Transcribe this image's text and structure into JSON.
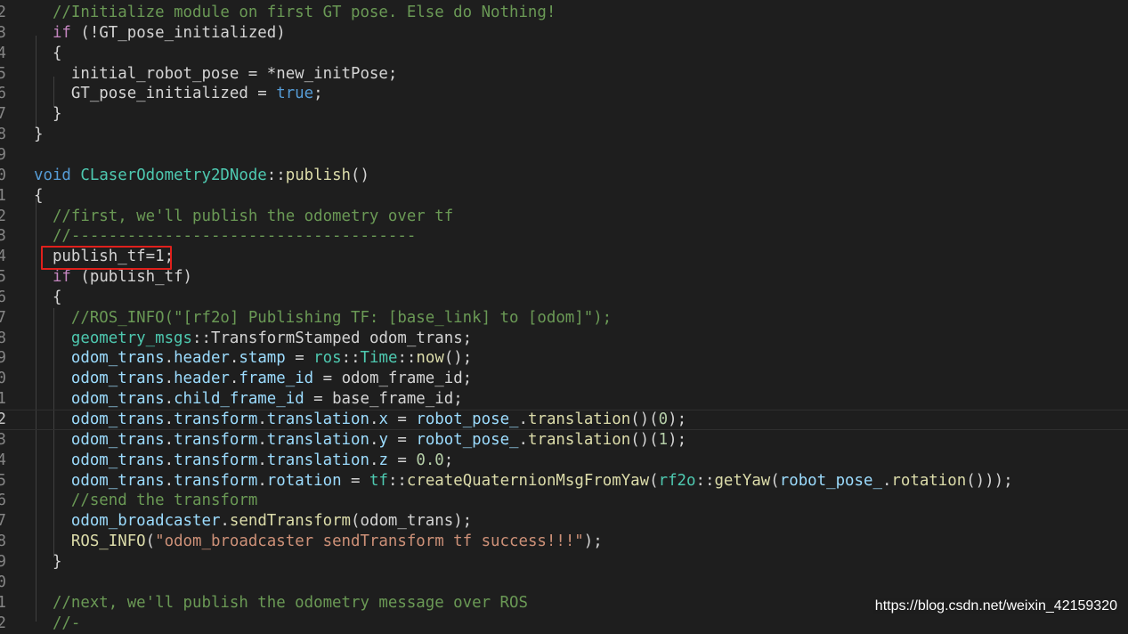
{
  "editor": {
    "lines": [
      {
        "num": "2",
        "tokens": [
          {
            "t": "  ",
            "c": "pl"
          },
          {
            "t": "//Initialize module on first GT pose. Else do Nothing!",
            "c": "cm"
          }
        ]
      },
      {
        "num": "3",
        "tokens": [
          {
            "t": "  ",
            "c": "pl"
          },
          {
            "t": "if",
            "c": "kc"
          },
          {
            "t": " (!GT_pose_initialized)",
            "c": "pl"
          }
        ]
      },
      {
        "num": "4",
        "tokens": [
          {
            "t": "  {",
            "c": "pl"
          }
        ]
      },
      {
        "num": "5",
        "tokens": [
          {
            "t": "    initial_robot_pose = *new_initPose;",
            "c": "pl"
          }
        ]
      },
      {
        "num": "6",
        "tokens": [
          {
            "t": "    GT_pose_initialized = ",
            "c": "pl"
          },
          {
            "t": "true",
            "c": "kw"
          },
          {
            "t": ";",
            "c": "pl"
          }
        ]
      },
      {
        "num": "7",
        "tokens": [
          {
            "t": "  }",
            "c": "pl"
          }
        ]
      },
      {
        "num": "8",
        "tokens": [
          {
            "t": "}",
            "c": "pl"
          }
        ]
      },
      {
        "num": "9",
        "tokens": []
      },
      {
        "num": "0",
        "tokens": [
          {
            "t": "void",
            "c": "kw"
          },
          {
            "t": " ",
            "c": "pl"
          },
          {
            "t": "CLaserOdometry2DNode",
            "c": "ty"
          },
          {
            "t": "::",
            "c": "pl"
          },
          {
            "t": "publish",
            "c": "fn"
          },
          {
            "t": "()",
            "c": "pl"
          }
        ]
      },
      {
        "num": "1",
        "tokens": [
          {
            "t": "{",
            "c": "pl"
          }
        ]
      },
      {
        "num": "2",
        "tokens": [
          {
            "t": "  ",
            "c": "pl"
          },
          {
            "t": "//first, we'll publish the odometry over tf",
            "c": "cm"
          }
        ]
      },
      {
        "num": "3",
        "tokens": [
          {
            "t": "  ",
            "c": "pl"
          },
          {
            "t": "//-------------------------------------",
            "c": "cm"
          }
        ]
      },
      {
        "num": "4",
        "tokens": [
          {
            "t": "  publish_tf=1;",
            "c": "pl"
          }
        ]
      },
      {
        "num": "5",
        "tokens": [
          {
            "t": "  ",
            "c": "pl"
          },
          {
            "t": "if",
            "c": "kc"
          },
          {
            "t": " (publish_tf)",
            "c": "pl"
          }
        ]
      },
      {
        "num": "6",
        "tokens": [
          {
            "t": "  {",
            "c": "pl"
          }
        ]
      },
      {
        "num": "7",
        "tokens": [
          {
            "t": "    ",
            "c": "pl"
          },
          {
            "t": "//ROS_INFO(\"[rf2o] Publishing TF: [base_link] to [odom]\");",
            "c": "cm"
          }
        ]
      },
      {
        "num": "8",
        "tokens": [
          {
            "t": "    ",
            "c": "pl"
          },
          {
            "t": "geometry_msgs",
            "c": "ty"
          },
          {
            "t": "::",
            "c": "pl"
          },
          {
            "t": "TransformStamped",
            "c": "pl"
          },
          {
            "t": " odom_trans;",
            "c": "pl"
          }
        ]
      },
      {
        "num": "9",
        "tokens": [
          {
            "t": "    ",
            "c": "pl"
          },
          {
            "t": "odom_trans",
            "c": "vr"
          },
          {
            "t": ".",
            "c": "pl"
          },
          {
            "t": "header",
            "c": "vr"
          },
          {
            "t": ".",
            "c": "pl"
          },
          {
            "t": "stamp",
            "c": "vr"
          },
          {
            "t": " = ",
            "c": "pl"
          },
          {
            "t": "ros",
            "c": "ty"
          },
          {
            "t": "::",
            "c": "pl"
          },
          {
            "t": "Time",
            "c": "ty"
          },
          {
            "t": "::",
            "c": "pl"
          },
          {
            "t": "now",
            "c": "fn"
          },
          {
            "t": "();",
            "c": "pl"
          }
        ]
      },
      {
        "num": "0",
        "tokens": [
          {
            "t": "    ",
            "c": "pl"
          },
          {
            "t": "odom_trans",
            "c": "vr"
          },
          {
            "t": ".",
            "c": "pl"
          },
          {
            "t": "header",
            "c": "vr"
          },
          {
            "t": ".",
            "c": "pl"
          },
          {
            "t": "frame_id",
            "c": "vr"
          },
          {
            "t": " = odom_frame_id;",
            "c": "pl"
          }
        ]
      },
      {
        "num": "1",
        "tokens": [
          {
            "t": "    ",
            "c": "pl"
          },
          {
            "t": "odom_trans",
            "c": "vr"
          },
          {
            "t": ".",
            "c": "pl"
          },
          {
            "t": "child_frame_id",
            "c": "vr"
          },
          {
            "t": " = base_frame_id;",
            "c": "pl"
          }
        ]
      },
      {
        "num": "2",
        "current": true,
        "tokens": [
          {
            "t": "    ",
            "c": "pl"
          },
          {
            "t": "odom_trans",
            "c": "vr"
          },
          {
            "t": ".",
            "c": "pl"
          },
          {
            "t": "transform",
            "c": "vr"
          },
          {
            "t": ".",
            "c": "pl"
          },
          {
            "t": "translation",
            "c": "vr"
          },
          {
            "t": ".",
            "c": "pl"
          },
          {
            "t": "x",
            "c": "vr"
          },
          {
            "t": " = ",
            "c": "pl"
          },
          {
            "t": "robot_pose_",
            "c": "vr"
          },
          {
            "t": ".",
            "c": "pl"
          },
          {
            "t": "translation",
            "c": "fn"
          },
          {
            "t": "()(",
            "c": "pl"
          },
          {
            "t": "0",
            "c": "nu"
          },
          {
            "t": ");",
            "c": "pl"
          }
        ]
      },
      {
        "num": "3",
        "tokens": [
          {
            "t": "    ",
            "c": "pl"
          },
          {
            "t": "odom_trans",
            "c": "vr"
          },
          {
            "t": ".",
            "c": "pl"
          },
          {
            "t": "transform",
            "c": "vr"
          },
          {
            "t": ".",
            "c": "pl"
          },
          {
            "t": "translation",
            "c": "vr"
          },
          {
            "t": ".",
            "c": "pl"
          },
          {
            "t": "y",
            "c": "vr"
          },
          {
            "t": " = ",
            "c": "pl"
          },
          {
            "t": "robot_pose_",
            "c": "vr"
          },
          {
            "t": ".",
            "c": "pl"
          },
          {
            "t": "translation",
            "c": "fn"
          },
          {
            "t": "()(",
            "c": "pl"
          },
          {
            "t": "1",
            "c": "nu"
          },
          {
            "t": ");",
            "c": "pl"
          }
        ]
      },
      {
        "num": "4",
        "tokens": [
          {
            "t": "    ",
            "c": "pl"
          },
          {
            "t": "odom_trans",
            "c": "vr"
          },
          {
            "t": ".",
            "c": "pl"
          },
          {
            "t": "transform",
            "c": "vr"
          },
          {
            "t": ".",
            "c": "pl"
          },
          {
            "t": "translation",
            "c": "vr"
          },
          {
            "t": ".",
            "c": "pl"
          },
          {
            "t": "z",
            "c": "vr"
          },
          {
            "t": " = ",
            "c": "pl"
          },
          {
            "t": "0.0",
            "c": "nu"
          },
          {
            "t": ";",
            "c": "pl"
          }
        ]
      },
      {
        "num": "5",
        "tokens": [
          {
            "t": "    ",
            "c": "pl"
          },
          {
            "t": "odom_trans",
            "c": "vr"
          },
          {
            "t": ".",
            "c": "pl"
          },
          {
            "t": "transform",
            "c": "vr"
          },
          {
            "t": ".",
            "c": "pl"
          },
          {
            "t": "rotation",
            "c": "vr"
          },
          {
            "t": " = ",
            "c": "pl"
          },
          {
            "t": "tf",
            "c": "ty"
          },
          {
            "t": "::",
            "c": "pl"
          },
          {
            "t": "createQuaternionMsgFromYaw",
            "c": "fn"
          },
          {
            "t": "(",
            "c": "pl"
          },
          {
            "t": "rf2o",
            "c": "ty"
          },
          {
            "t": "::",
            "c": "pl"
          },
          {
            "t": "getYaw",
            "c": "fn"
          },
          {
            "t": "(",
            "c": "pl"
          },
          {
            "t": "robot_pose_",
            "c": "vr"
          },
          {
            "t": ".",
            "c": "pl"
          },
          {
            "t": "rotation",
            "c": "fn"
          },
          {
            "t": "()));",
            "c": "pl"
          }
        ]
      },
      {
        "num": "6",
        "tokens": [
          {
            "t": "    ",
            "c": "pl"
          },
          {
            "t": "//send the transform",
            "c": "cm"
          }
        ]
      },
      {
        "num": "7",
        "tokens": [
          {
            "t": "    ",
            "c": "pl"
          },
          {
            "t": "odom_broadcaster",
            "c": "vr"
          },
          {
            "t": ".",
            "c": "pl"
          },
          {
            "t": "sendTransform",
            "c": "fn"
          },
          {
            "t": "(odom_trans);",
            "c": "pl"
          }
        ]
      },
      {
        "num": "8",
        "tokens": [
          {
            "t": "    ",
            "c": "pl"
          },
          {
            "t": "ROS_INFO",
            "c": "fn"
          },
          {
            "t": "(",
            "c": "pl"
          },
          {
            "t": "\"odom_broadcaster sendTransform tf success!!!\"",
            "c": "st"
          },
          {
            "t": ");",
            "c": "pl"
          }
        ]
      },
      {
        "num": "9",
        "tokens": [
          {
            "t": "  }",
            "c": "pl"
          }
        ]
      },
      {
        "num": "0",
        "tokens": []
      },
      {
        "num": "1",
        "tokens": [
          {
            "t": "  ",
            "c": "pl"
          },
          {
            "t": "//next, we'll publish the odometry message over ROS",
            "c": "cm"
          }
        ]
      },
      {
        "num": "2",
        "tokens": [
          {
            "t": "  ",
            "c": "pl"
          },
          {
            "t": "//-",
            "c": "cm"
          }
        ]
      }
    ]
  },
  "watermark": "https://blog.csdn.net/weixin_42159320",
  "colors": {
    "background": "#1e1e1e",
    "comment": "#6a9955",
    "keyword": "#569cd6",
    "control": "#c586c0",
    "type": "#4ec9b0",
    "function": "#dcdcaa",
    "variable": "#9cdcfe",
    "string": "#ce9178",
    "number": "#b5cea8",
    "highlight_box": "#e0201c"
  }
}
